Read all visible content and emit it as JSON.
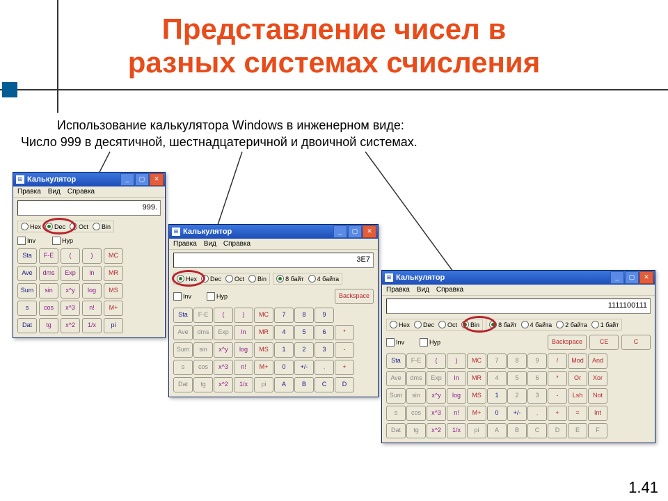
{
  "title_line1": "Представление чисел в",
  "title_line2": "разных системах счисления",
  "body_line1": "Использование калькулятора Windows в инженерном виде:",
  "body_line2": "Число 999 в десятичной, шестнадцатеричной и двоичной системах.",
  "page_number": "1.41",
  "calc_title": "Калькулятор",
  "menu": {
    "edit": "Правка",
    "view": "Вид",
    "help": "Справка"
  },
  "radix": {
    "hex": "Hex",
    "dec": "Dec",
    "oct": "Oct",
    "bin": "Bin"
  },
  "bytes": {
    "b8": "8 байт",
    "b4": "4 байта",
    "b2": "2 байта",
    "b1": "1 байт"
  },
  "inv": "Inv",
  "hyp": "Hyp",
  "backspace": "Backspace",
  "ce": "CE",
  "c": "C",
  "displays": {
    "dec": "999.",
    "hex": "3E7",
    "bin": "1111100111"
  },
  "keys": {
    "row1": [
      "Sta",
      "F-E",
      "(",
      ")",
      "MC"
    ],
    "row2": [
      "Ave",
      "dms",
      "Exp",
      "ln",
      "MR"
    ],
    "row3": [
      "Sum",
      "sin",
      "x^y",
      "log",
      "MS"
    ],
    "row4": [
      "s",
      "cos",
      "x^3",
      "n!",
      "M+"
    ],
    "row5": [
      "Dat",
      "tg",
      "x^2",
      "1/x",
      "pi"
    ],
    "num": {
      "r1": [
        "7",
        "8",
        "9",
        "/",
        "Mod",
        "And"
      ],
      "r2": [
        "4",
        "5",
        "6",
        "*",
        "Or",
        "Xor"
      ],
      "r3": [
        "1",
        "2",
        "3",
        "-",
        "Lsh",
        "Not"
      ],
      "r4": [
        "0",
        "+/-",
        ",",
        "+",
        "=",
        "Int"
      ],
      "r5": [
        "A",
        "B",
        "C",
        "D",
        "E",
        "F"
      ]
    }
  }
}
